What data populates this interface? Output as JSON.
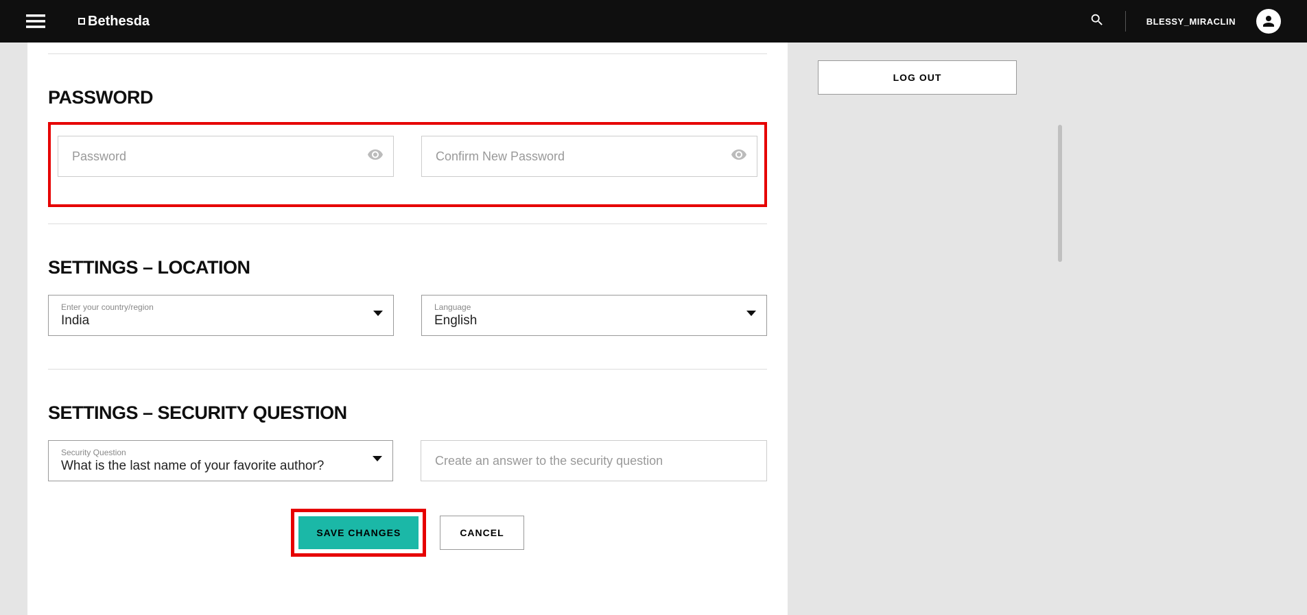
{
  "header": {
    "logo_text": "Bethesda",
    "username": "BLESSY_MIRACLIN"
  },
  "sidebar": {
    "logout_label": "LOG OUT"
  },
  "password_section": {
    "title": "PASSWORD",
    "password_placeholder": "Password",
    "confirm_placeholder": "Confirm New Password"
  },
  "location_section": {
    "title": "SETTINGS – LOCATION",
    "country_label": "Enter your country/region",
    "country_value": "India",
    "language_label": "Language",
    "language_value": "English"
  },
  "security_section": {
    "title": "SETTINGS – SECURITY QUESTION",
    "question_label": "Security Question",
    "question_value": "What is the last name of your favorite author?",
    "answer_placeholder": "Create an answer to the security question"
  },
  "buttons": {
    "save": "SAVE CHANGES",
    "cancel": "CANCEL"
  }
}
